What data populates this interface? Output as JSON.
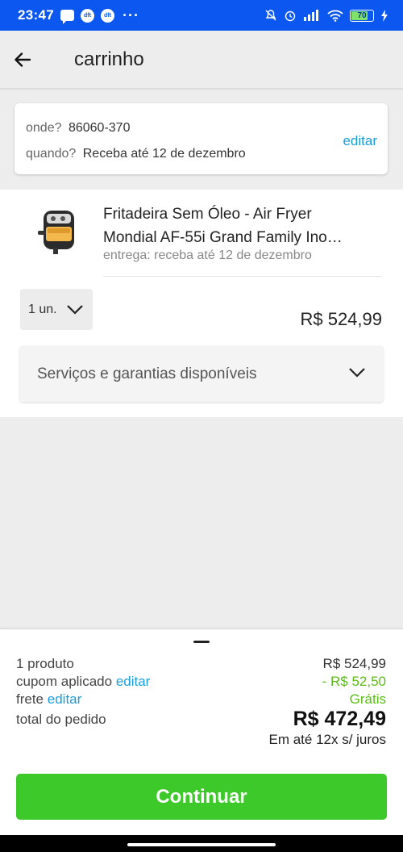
{
  "status_bar": {
    "time": "23:47",
    "icon_chat": "chat-icon",
    "app_icon_1": "dft",
    "app_icon_2": "dft",
    "more": "···",
    "battery_level": "70"
  },
  "header": {
    "title": "carrinho",
    "back_icon": "back-arrow-icon"
  },
  "delivery": {
    "where_label": "onde?",
    "where_value": "86060-370",
    "when_label": "quando?",
    "when_value": "Receba até 12 de dezembro",
    "edit_label": "editar"
  },
  "product": {
    "title_line1": "Fritadeira Sem Óleo - Air Fryer",
    "title_line2": "Mondial AF-55i Grand Family Ino…",
    "delivery_note": "entrega: receba até 12 de dezembro",
    "quantity": "1 un.",
    "price": "R$ 524,99"
  },
  "services": {
    "label": "Serviços e garantias disponíveis"
  },
  "summary": {
    "products_label": "1 produto",
    "products_value": "R$ 524,99",
    "coupon_label": "cupom aplicado",
    "coupon_edit": "editar",
    "coupon_value": "- R$ 52,50",
    "shipping_label": "frete",
    "shipping_edit": "editar",
    "shipping_value": "Grátis",
    "total_label": "total do pedido",
    "total_value": "R$ 472,49",
    "installments": "Em até 12x s/ juros"
  },
  "cta": {
    "continue_label": "Continuar"
  },
  "colors": {
    "status_bar": "#0b57f0",
    "link": "#1a9ed9",
    "green": "#3dc92a",
    "discount": "#5bbd14"
  }
}
